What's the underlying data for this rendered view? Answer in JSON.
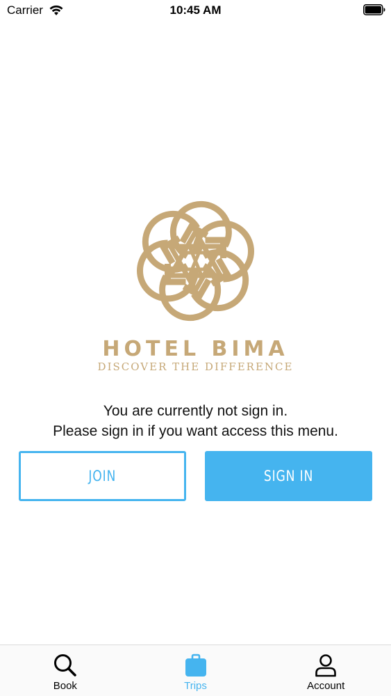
{
  "status_bar": {
    "carrier": "Carrier",
    "time": "10:45 AM"
  },
  "brand": {
    "name": "HOTEL BIMA",
    "tagline": "DISCOVER THE DIFFERENCE",
    "color": "#c6a877"
  },
  "message": {
    "line1": "You are currently not sign in.",
    "line2": "Please sign in if you want access this menu."
  },
  "buttons": {
    "join_label": "JOIN",
    "signin_label": "SIGN IN"
  },
  "tabs": [
    {
      "label": "Book",
      "icon": "search-icon",
      "active": false
    },
    {
      "label": "Trips",
      "icon": "suitcase-icon",
      "active": true
    },
    {
      "label": "Account",
      "icon": "person-icon",
      "active": false
    }
  ],
  "colors": {
    "accent": "#45b4ef",
    "text": "#111111"
  }
}
